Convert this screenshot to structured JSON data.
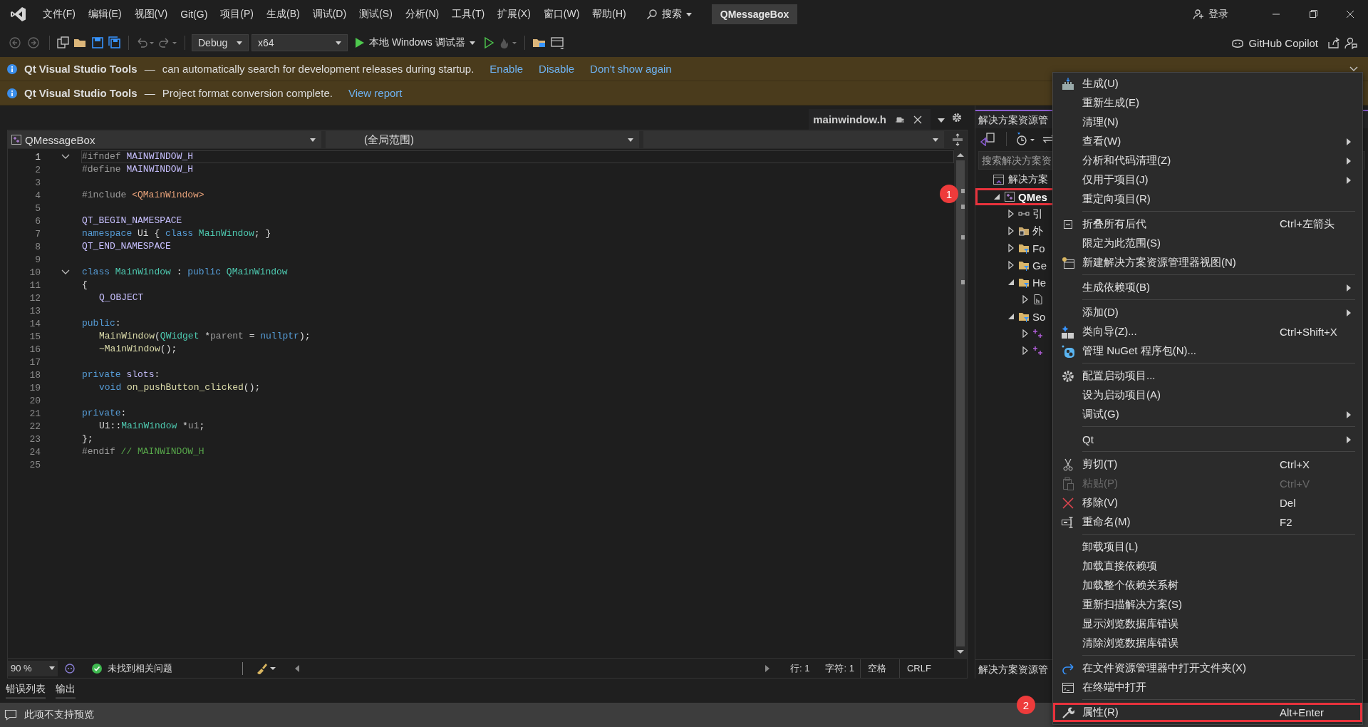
{
  "menu_bar": {
    "menus": [
      "文件(F)",
      "编辑(E)",
      "视图(V)",
      "Git(G)",
      "项目(P)",
      "生成(B)",
      "调试(D)",
      "测试(S)",
      "分析(N)",
      "工具(T)",
      "扩展(X)",
      "窗口(W)",
      "帮助(H)"
    ],
    "search": "搜索",
    "title": "QMessageBox",
    "login": "登录"
  },
  "toolbar": {
    "configuration": "Debug",
    "platform": "x64",
    "debugger": "本地 Windows 调试器",
    "copilot": "GitHub Copilot"
  },
  "info_bars": [
    {
      "source": "Qt Visual Studio Tools",
      "dash": "—",
      "message": "can automatically search for development releases during startup.",
      "links": [
        "Enable",
        "Disable",
        "Don't show again"
      ]
    },
    {
      "source": "Qt Visual Studio Tools",
      "dash": "—",
      "message": "Project format conversion complete.",
      "links": [
        "View report"
      ]
    }
  ],
  "editor": {
    "tab": {
      "label": "mainwindow.h"
    },
    "nav": {
      "project": "QMessageBox",
      "scope": "(全局范围)"
    },
    "lines": [
      {
        "number": "1",
        "current": true,
        "fold": true,
        "indent": false,
        "tokens": [
          {
            "text": "#ifndef ",
            "kind": "pp"
          },
          {
            "text": "MAINWINDOW_H",
            "kind": "macro"
          }
        ]
      },
      {
        "number": "2",
        "current": false,
        "fold": false,
        "indent": false,
        "tokens": [
          {
            "text": "#define ",
            "kind": "pp"
          },
          {
            "text": "MAINWINDOW_H",
            "kind": "macro"
          }
        ]
      },
      {
        "number": "3",
        "current": false,
        "fold": false,
        "indent": false
      },
      {
        "number": "4",
        "current": false,
        "fold": false,
        "indent": false,
        "tokens": [
          {
            "text": "#include ",
            "kind": "pp"
          },
          {
            "text": "<QMainWindow>",
            "kind": "str"
          }
        ]
      },
      {
        "number": "5",
        "current": false,
        "fold": false,
        "indent": false
      },
      {
        "number": "6",
        "current": false,
        "fold": false,
        "indent": false,
        "tokens": [
          {
            "text": "QT_BEGIN_NAMESPACE",
            "kind": "macro"
          }
        ]
      },
      {
        "number": "7",
        "current": false,
        "fold": false,
        "indent": false,
        "tokens": [
          {
            "text": "namespace ",
            "kind": "kw"
          },
          {
            "text": "Ui { ",
            "kind": "plain"
          },
          {
            "text": "class ",
            "kind": "kw"
          },
          {
            "text": "MainWindow",
            "kind": "type"
          },
          {
            "text": "; }",
            "kind": "plain"
          }
        ]
      },
      {
        "number": "8",
        "current": false,
        "fold": false,
        "indent": false,
        "tokens": [
          {
            "text": "QT_END_NAMESPACE",
            "kind": "macro"
          }
        ]
      },
      {
        "number": "9",
        "current": false,
        "fold": false,
        "indent": false
      },
      {
        "number": "10",
        "current": false,
        "fold": true,
        "indent": false,
        "tokens": [
          {
            "text": "class ",
            "kind": "kw"
          },
          {
            "text": "MainWindow",
            "kind": "type"
          },
          {
            "text": " : ",
            "kind": "plain"
          },
          {
            "text": "public ",
            "kind": "kw"
          },
          {
            "text": "QMainWindow",
            "kind": "type"
          }
        ]
      },
      {
        "number": "11",
        "current": false,
        "fold": false,
        "indent": false,
        "tokens": [
          {
            "text": "{",
            "kind": "plain"
          }
        ]
      },
      {
        "number": "12",
        "current": false,
        "fold": false,
        "indent": true,
        "tokens": [
          {
            "text": "Q_OBJECT",
            "kind": "macro"
          }
        ]
      },
      {
        "number": "13",
        "current": false,
        "fold": false,
        "indent": false
      },
      {
        "number": "14",
        "current": false,
        "fold": false,
        "indent": false,
        "tokens": [
          {
            "text": "public",
            "kind": "kw"
          },
          {
            "text": ":",
            "kind": "plain"
          }
        ]
      },
      {
        "number": "15",
        "current": false,
        "fold": false,
        "indent": true,
        "tokens": [
          {
            "text": "MainWindow",
            "kind": "func"
          },
          {
            "text": "(",
            "kind": "plain"
          },
          {
            "text": "QWidget",
            "kind": "type"
          },
          {
            "text": " *",
            "kind": "plain"
          },
          {
            "text": "parent",
            "kind": "param"
          },
          {
            "text": " = ",
            "kind": "plain"
          },
          {
            "text": "nullptr",
            "kind": "kw"
          },
          {
            "text": ");",
            "kind": "plain"
          }
        ]
      },
      {
        "number": "16",
        "current": false,
        "fold": false,
        "indent": true,
        "tokens": [
          {
            "text": "~MainWindow",
            "kind": "func"
          },
          {
            "text": "();",
            "kind": "plain"
          }
        ]
      },
      {
        "number": "17",
        "current": false,
        "fold": false,
        "indent": false
      },
      {
        "number": "18",
        "current": false,
        "fold": false,
        "indent": false,
        "tokens": [
          {
            "text": "private ",
            "kind": "kw"
          },
          {
            "text": "slots",
            "kind": "macro"
          },
          {
            "text": ":",
            "kind": "plain"
          }
        ]
      },
      {
        "number": "19",
        "current": false,
        "fold": false,
        "indent": true,
        "tokens": [
          {
            "text": "void ",
            "kind": "kw"
          },
          {
            "text": "on_pushButton_clicked",
            "kind": "func"
          },
          {
            "text": "();",
            "kind": "plain"
          }
        ]
      },
      {
        "number": "20",
        "current": false,
        "fold": false,
        "indent": false
      },
      {
        "number": "21",
        "current": false,
        "fold": false,
        "indent": false,
        "tokens": [
          {
            "text": "private",
            "kind": "kw"
          },
          {
            "text": ":",
            "kind": "plain"
          }
        ]
      },
      {
        "number": "22",
        "current": false,
        "fold": false,
        "indent": true,
        "tokens": [
          {
            "text": "Ui::",
            "kind": "plain"
          },
          {
            "text": "MainWindow",
            "kind": "type"
          },
          {
            "text": " *",
            "kind": "plain"
          },
          {
            "text": "ui",
            "kind": "param"
          },
          {
            "text": ";",
            "kind": "plain"
          }
        ]
      },
      {
        "number": "23",
        "current": false,
        "fold": false,
        "indent": false,
        "tokens": [
          {
            "text": "};",
            "kind": "plain"
          }
        ]
      },
      {
        "number": "24",
        "current": false,
        "fold": false,
        "indent": false,
        "tokens": [
          {
            "text": "#endif ",
            "kind": "pp"
          },
          {
            "text": "// MAINWINDOW_H",
            "kind": "cmt"
          }
        ]
      },
      {
        "number": "25",
        "current": false,
        "fold": false,
        "indent": false
      }
    ],
    "status": {
      "zoom": "90 %",
      "issues": "未找到相关问题",
      "line": "行: 1",
      "char": "字符: 1",
      "indent": "空格",
      "eol": "CRLF"
    }
  },
  "bottom_tabs": [
    "错误列表",
    "输出"
  ],
  "status_bar": {
    "message": "此项不支持预览"
  },
  "solution_explorer": {
    "title": "解决方案资源管",
    "search_placeholder": "搜索解决方案资",
    "solution": {
      "label": "解决方案"
    },
    "tree": [
      {
        "label": "QMes",
        "kind": "project",
        "expanded": true,
        "selected": true,
        "marked": true,
        "children": [
          {
            "label": "引",
            "kind": "references",
            "expanded": false,
            "selected": false,
            "marked": false
          },
          {
            "label": "外",
            "kind": "external",
            "expanded": false,
            "selected": false,
            "marked": false
          },
          {
            "label": "Fo",
            "kind": "filter",
            "expanded": false,
            "selected": false,
            "marked": false
          },
          {
            "label": "Ge",
            "kind": "filter",
            "expanded": false,
            "selected": false,
            "marked": false
          },
          {
            "label": "He",
            "kind": "filter",
            "expanded": true,
            "selected": false,
            "marked": false,
            "children": [
              {
                "kind": "header",
                "expanded": false,
                "marked": false
              }
            ]
          },
          {
            "label": "So",
            "kind": "filter",
            "expanded": true,
            "selected": false,
            "marked": false,
            "children": [
              {
                "kind": "source",
                "expanded": false,
                "marked": false
              },
              {
                "kind": "source",
                "expanded": false,
                "marked": false
              }
            ]
          }
        ]
      }
    ],
    "bottom_tab": "解决方案资源管"
  },
  "context_menu": {
    "groups": [
      [
        {
          "label": "生成(U)",
          "submenu": false,
          "disabled": false,
          "marked": false
        },
        {
          "label": "重新生成(E)",
          "submenu": false,
          "disabled": false,
          "marked": false
        },
        {
          "label": "清理(N)",
          "submenu": false,
          "disabled": false,
          "marked": false
        },
        {
          "label": "查看(W)",
          "submenu": true,
          "disabled": false,
          "marked": false
        },
        {
          "label": "分析和代码清理(Z)",
          "submenu": true,
          "disabled": false,
          "marked": false
        },
        {
          "label": "仅用于项目(J)",
          "submenu": true,
          "disabled": false,
          "marked": false
        },
        {
          "label": "重定向项目(R)",
          "submenu": false,
          "disabled": false,
          "marked": false
        }
      ],
      [
        {
          "label": "折叠所有后代",
          "shortcut": "Ctrl+左箭头",
          "submenu": false,
          "disabled": false,
          "marked": false
        },
        {
          "label": "限定为此范围(S)",
          "submenu": false,
          "disabled": false,
          "marked": false
        },
        {
          "label": "新建解决方案资源管理器视图(N)",
          "submenu": false,
          "disabled": false,
          "marked": false
        }
      ],
      [
        {
          "label": "生成依赖项(B)",
          "submenu": true,
          "disabled": false,
          "marked": false
        }
      ],
      [
        {
          "label": "添加(D)",
          "submenu": true,
          "disabled": false,
          "marked": false
        },
        {
          "label": "类向导(Z)...",
          "shortcut": "Ctrl+Shift+X",
          "submenu": false,
          "disabled": false,
          "marked": false
        },
        {
          "label": "管理 NuGet 程序包(N)...",
          "submenu": false,
          "disabled": false,
          "marked": false
        }
      ],
      [
        {
          "label": "配置启动项目...",
          "submenu": false,
          "disabled": false,
          "marked": false
        },
        {
          "label": "设为启动项目(A)",
          "submenu": false,
          "disabled": false,
          "marked": false
        },
        {
          "label": "调试(G)",
          "submenu": true,
          "disabled": false,
          "marked": false
        }
      ],
      [
        {
          "label": "Qt",
          "submenu": true,
          "disabled": false,
          "marked": false
        }
      ],
      [
        {
          "label": "剪切(T)",
          "shortcut": "Ctrl+X",
          "submenu": false,
          "disabled": false,
          "marked": false
        },
        {
          "label": "粘贴(P)",
          "shortcut": "Ctrl+V",
          "submenu": false,
          "disabled": true,
          "marked": false
        },
        {
          "label": "移除(V)",
          "shortcut": "Del",
          "submenu": false,
          "disabled": false,
          "marked": false
        },
        {
          "label": "重命名(M)",
          "shortcut": "F2",
          "submenu": false,
          "disabled": false,
          "marked": false
        }
      ],
      [
        {
          "label": "卸载项目(L)",
          "submenu": false,
          "disabled": false,
          "marked": false
        },
        {
          "label": "加载直接依赖项",
          "submenu": false,
          "disabled": false,
          "marked": false
        },
        {
          "label": "加载整个依赖关系树",
          "submenu": false,
          "disabled": false,
          "marked": false
        },
        {
          "label": "重新扫描解决方案(S)",
          "submenu": false,
          "disabled": false,
          "marked": false
        },
        {
          "label": "显示浏览数据库错误",
          "submenu": false,
          "disabled": false,
          "marked": false
        },
        {
          "label": "清除浏览数据库错误",
          "submenu": false,
          "disabled": false,
          "marked": false
        }
      ],
      [
        {
          "label": "在文件资源管理器中打开文件夹(X)",
          "submenu": false,
          "disabled": false,
          "marked": false
        },
        {
          "label": "在终端中打开",
          "submenu": false,
          "disabled": false,
          "marked": false
        }
      ],
      [
        {
          "label": "属性(R)",
          "shortcut": "Alt+Enter",
          "submenu": false,
          "disabled": false,
          "marked": true
        }
      ]
    ]
  },
  "annotations": [
    {
      "number": "1"
    },
    {
      "number": "2"
    }
  ]
}
